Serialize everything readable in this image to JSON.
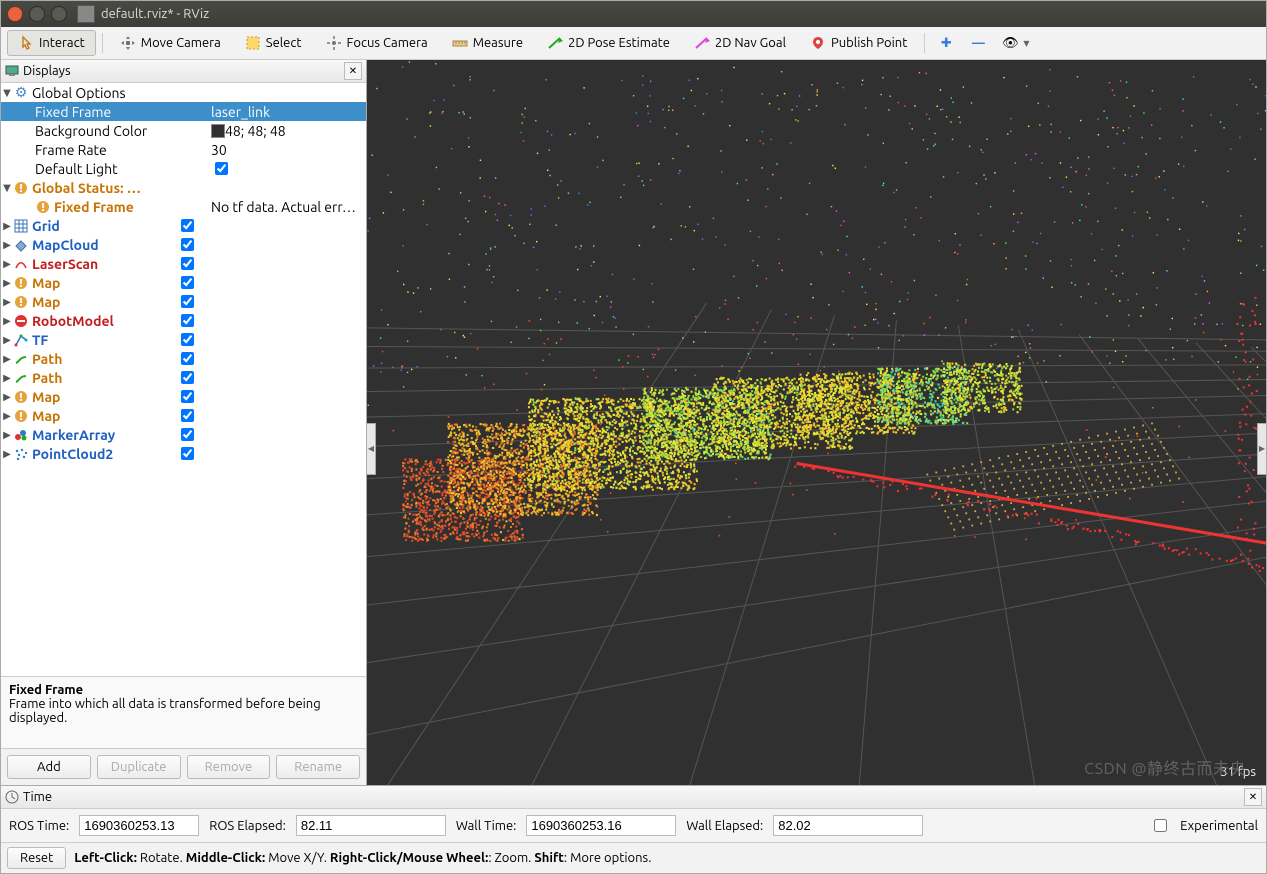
{
  "window": {
    "title": "default.rviz* - RViz"
  },
  "toolbar": {
    "interact": "Interact",
    "move_camera": "Move Camera",
    "select": "Select",
    "focus_camera": "Focus Camera",
    "measure": "Measure",
    "pose_estimate": "2D Pose Estimate",
    "nav_goal": "2D Nav Goal",
    "publish_point": "Publish Point"
  },
  "displays": {
    "title": "Displays",
    "global_options": {
      "label": "Global Options",
      "fixed_frame": {
        "label": "Fixed Frame",
        "value": "laser_link"
      },
      "background_color": {
        "label": "Background Color",
        "value": "48; 48; 48"
      },
      "frame_rate": {
        "label": "Frame Rate",
        "value": "30"
      },
      "default_light": {
        "label": "Default Light",
        "checked": true
      }
    },
    "global_status": {
      "label": "Global Status: …",
      "fixed_frame": {
        "label": "Fixed Frame",
        "value": "No tf data.  Actual err…"
      }
    },
    "items": [
      {
        "label": "Grid",
        "style": "ok",
        "icon": "grid",
        "checked": true
      },
      {
        "label": "MapCloud",
        "style": "ok",
        "icon": "grid2",
        "checked": true
      },
      {
        "label": "LaserScan",
        "style": "err",
        "icon": "laser",
        "checked": true
      },
      {
        "label": "Map",
        "style": "warn",
        "icon": "warn",
        "checked": true
      },
      {
        "label": "Map",
        "style": "warn",
        "icon": "warn",
        "checked": true
      },
      {
        "label": "RobotModel",
        "style": "err",
        "icon": "stop",
        "checked": true
      },
      {
        "label": "TF",
        "style": "ok",
        "icon": "tf",
        "checked": true
      },
      {
        "label": "Path",
        "style": "warn",
        "icon": "path",
        "checked": true
      },
      {
        "label": "Path",
        "style": "warn",
        "icon": "path",
        "checked": true
      },
      {
        "label": "Map",
        "style": "warn",
        "icon": "warn",
        "checked": true
      },
      {
        "label": "Map",
        "style": "warn",
        "icon": "warn",
        "checked": true
      },
      {
        "label": "MarkerArray",
        "style": "ok",
        "icon": "marker",
        "checked": true
      },
      {
        "label": "PointCloud2",
        "style": "ok",
        "icon": "pc2",
        "checked": true
      }
    ],
    "description": {
      "title": "Fixed Frame",
      "body": "Frame into which all data is transformed before being displayed."
    },
    "buttons": {
      "add": "Add",
      "duplicate": "Duplicate",
      "remove": "Remove",
      "rename": "Rename"
    }
  },
  "view": {
    "fps": "31 fps"
  },
  "time": {
    "title": "Time",
    "ros_time_label": "ROS Time:",
    "ros_time": "1690360253.13",
    "ros_elapsed_label": "ROS Elapsed:",
    "ros_elapsed": "82.11",
    "wall_time_label": "Wall Time:",
    "wall_time": "1690360253.16",
    "wall_elapsed_label": "Wall Elapsed:",
    "wall_elapsed": "82.02",
    "experimental": "Experimental"
  },
  "statusbar": {
    "reset": "Reset",
    "hint_lc": "Left-Click:",
    "hint_lc_v": " Rotate. ",
    "hint_mc": "Middle-Click:",
    "hint_mc_v": " Move X/Y. ",
    "hint_rc": "Right-Click/Mouse Wheel:",
    "hint_rc_v": ": Zoom. ",
    "hint_sh": "Shift",
    "hint_sh_v": ": More options."
  },
  "watermark": "CSDN @静终古而未央"
}
